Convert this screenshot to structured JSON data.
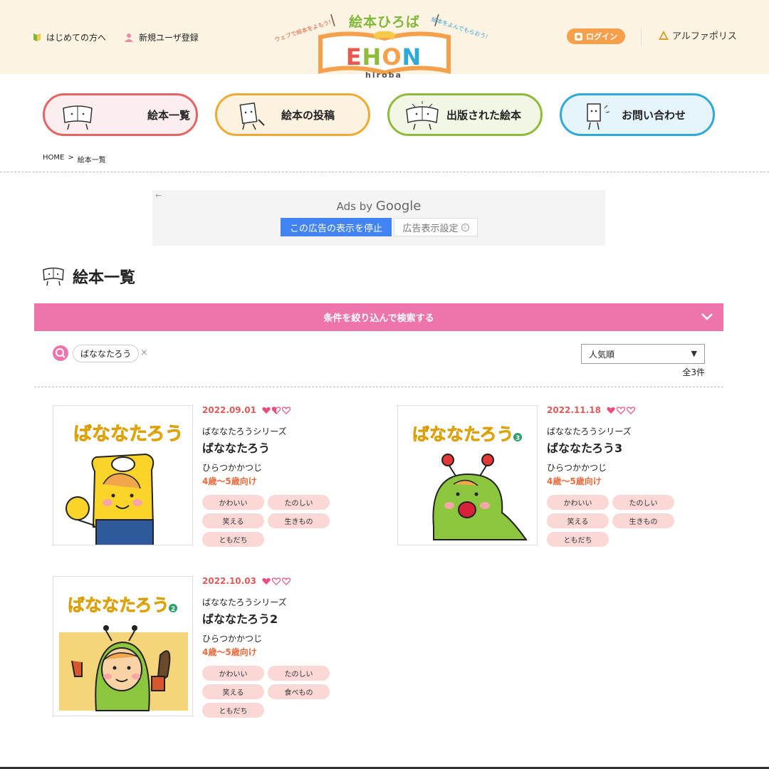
{
  "header": {
    "first_time": "はじめての方へ",
    "register": "新規ユーザ登録",
    "logo": {
      "title": "絵本ひろば",
      "tag_left": "ウェブで絵本をよもう!",
      "tag_right": "絵本をよんでもらおう!",
      "ehon": [
        "E",
        "H",
        "O",
        "N"
      ],
      "hiroba": "hiroba"
    },
    "login": "ログイン",
    "alphapolis": "アルファポリス"
  },
  "nav": [
    {
      "label": "絵本一覧"
    },
    {
      "label": "絵本の投稿"
    },
    {
      "label": "出版された絵本"
    },
    {
      "label": "お問い合わせ"
    }
  ],
  "breadcrumb": {
    "home": "HOME",
    "sep": ">",
    "current": "絵本一覧"
  },
  "ad": {
    "back": "←",
    "ads_by": "Ads by",
    "google": "Google",
    "stop": "この広告の表示を停止",
    "settings": "広告表示設定",
    "info": "i"
  },
  "page_title": "絵本一覧",
  "filter_bar": "条件を絞り込んで検索する",
  "search_chip": "ばななたろう",
  "chip_remove": "×",
  "sort": {
    "selected": "人気順",
    "arrow": "▼"
  },
  "count": "全3件",
  "colors": {
    "accent_pink": "#ee74ac",
    "date_red": "#e05a5a",
    "age_orange": "#e86a3a",
    "tag_bg": "#fbd7d5",
    "login_orange": "#f6a04b"
  },
  "books": [
    {
      "date": "2022.09.01",
      "hearts": [
        "full",
        "half",
        "empty"
      ],
      "series": "ばななたろうシリーズ",
      "title": "ばななたろう",
      "author": "ひらつかかつじ",
      "age": "4歳〜5歳向け",
      "cover_text": "ばななたろう",
      "tags": [
        "かわいい",
        "たのしい",
        "笑える",
        "生きもの",
        "ともだち"
      ]
    },
    {
      "date": "2022.11.18",
      "hearts": [
        "full",
        "empty",
        "empty"
      ],
      "series": "ばななたろうシリーズ",
      "title": "ばななたろう3",
      "author": "ひらつかかつじ",
      "age": "4歳〜5歳向け",
      "cover_text": "ばななたろう",
      "cover_num": "3",
      "tags": [
        "かわいい",
        "たのしい",
        "笑える",
        "生きもの",
        "ともだち"
      ]
    },
    {
      "date": "2022.10.03",
      "hearts": [
        "full",
        "empty",
        "empty"
      ],
      "series": "ばななたろうシリーズ",
      "title": "ばななたろう2",
      "author": "ひらつかかつじ",
      "age": "4歳〜5歳向け",
      "cover_text": "ばななたろう",
      "cover_num": "2",
      "tags": [
        "かわいい",
        "たのしい",
        "笑える",
        "食べもの",
        "ともだち"
      ]
    }
  ]
}
